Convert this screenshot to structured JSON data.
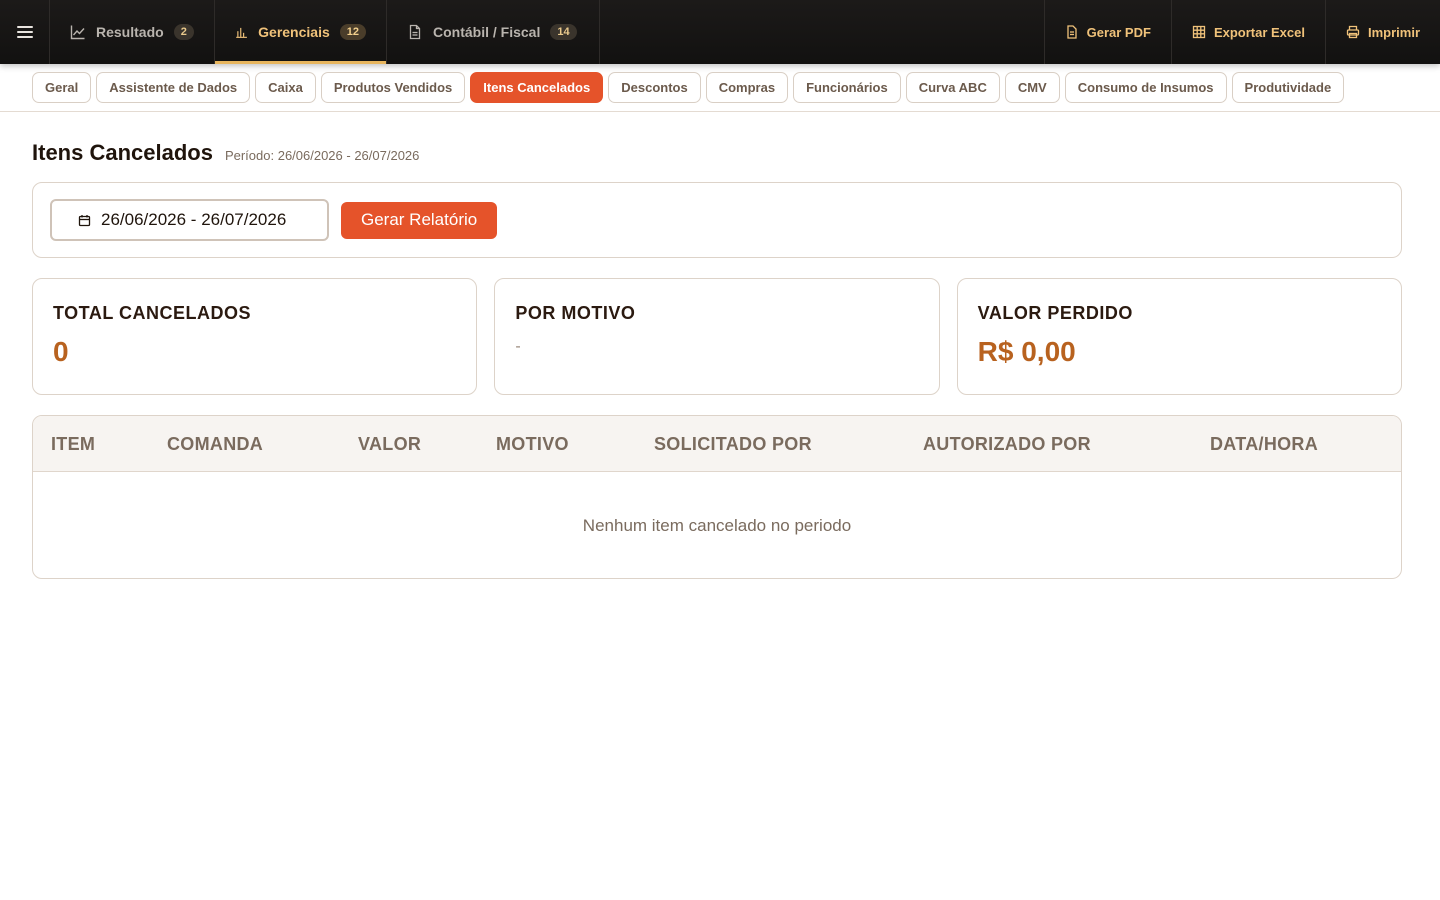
{
  "topbar": {
    "tabs": [
      {
        "label": "Resultado",
        "count": "2"
      },
      {
        "label": "Gerenciais",
        "count": "12"
      },
      {
        "label": "Contábil / Fiscal",
        "count": "14"
      }
    ],
    "actions": {
      "pdf": "Gerar PDF",
      "excel": "Exportar Excel",
      "print": "Imprimir"
    }
  },
  "subtabs": [
    "Geral",
    "Assistente de Dados",
    "Caixa",
    "Produtos Vendidos",
    "Itens Cancelados",
    "Descontos",
    "Compras",
    "Funcionários",
    "Curva ABC",
    "CMV",
    "Consumo de Insumos",
    "Produtividade"
  ],
  "page": {
    "title": "Itens Cancelados",
    "period": "Período: 26/06/2026 - 26/07/2026"
  },
  "filter": {
    "date_range": "26/06/2026 - 26/07/2026",
    "generate_label": "Gerar Relatório"
  },
  "stats": {
    "total_label": "TOTAL CANCELADOS",
    "total_value": "0",
    "motivo_label": "POR MOTIVO",
    "motivo_value": "-",
    "valor_label": "VALOR PERDIDO",
    "valor_value": "R$ 0,00"
  },
  "table": {
    "headers": [
      "ITEM",
      "COMANDA",
      "VALOR",
      "MOTIVO",
      "SOLICITADO POR",
      "AUTORIZADO POR",
      "DATA/HORA"
    ],
    "empty_text": "Nenhum item cancelado no periodo"
  },
  "colors": {
    "accent": "#e5532a",
    "highlight": "#f0c27a",
    "value": "#b8621f"
  }
}
